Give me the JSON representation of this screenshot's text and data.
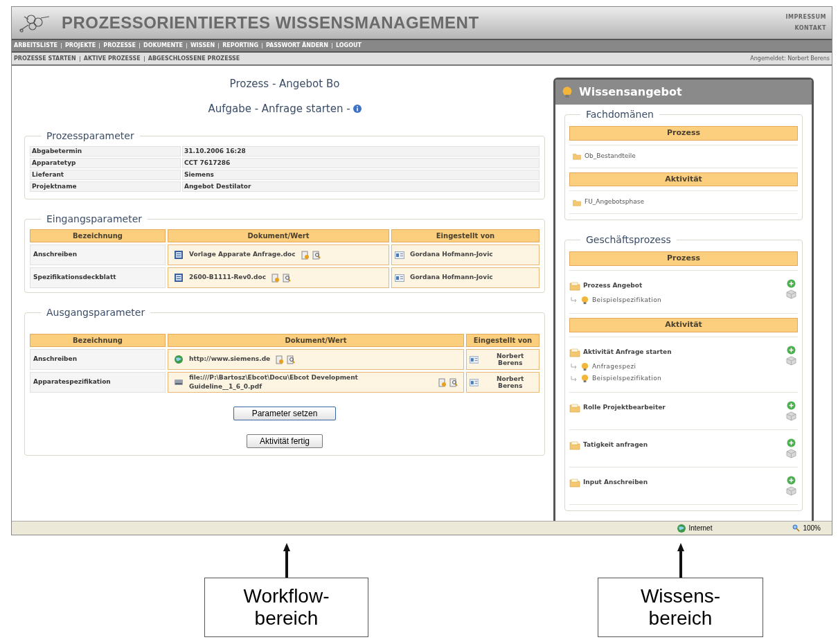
{
  "header": {
    "title": "PROZESSORIENTIERTES WISSENSMANAGEMENT",
    "links": [
      "IMPRESSUM",
      "KONTAKT"
    ]
  },
  "nav": [
    "ARBEITSLISTE",
    "PROJEKTE",
    "PROZESSE",
    "DOKUMENTE",
    "WISSEN",
    "REPORTING",
    "PASSWORT ÄNDERN",
    "LOGOUT"
  ],
  "subnav": {
    "items": [
      "PROZESSE STARTEN",
      "AKTIVE PROZESSE",
      "ABGESCHLOSSENE PROZESSE"
    ],
    "logged_in": "Angemeldet: Norbert Berens"
  },
  "workflow": {
    "process_title": "Prozess - Angebot Bo",
    "task_title": "Aufgabe - Anfrage starten -",
    "prozessparameter": {
      "legend": "Prozessparameter",
      "rows": [
        {
          "label": "Abgabetermin",
          "value": "31.10.2006 16:28"
        },
        {
          "label": "Apparatetyp",
          "value": "CCT 7617286"
        },
        {
          "label": "Lieferant",
          "value": "Siemens"
        },
        {
          "label": "Projektname",
          "value": "Angebot Destilator"
        }
      ]
    },
    "eingangsparameter": {
      "legend": "Eingangsparameter",
      "columns": [
        "Bezeichnung",
        "Dokument/Wert",
        "Eingestellt von"
      ],
      "rows": [
        {
          "name": "Anschreiben",
          "document": "Vorlage Apparate Anfrage.doc",
          "kind": "word",
          "user": "Gordana Hofmann-Jovic"
        },
        {
          "name": "Spezifikationsdeckblatt",
          "document": "2600-B1111-Rev0.doc",
          "kind": "word",
          "user": "Gordana Hofmann-Jovic"
        }
      ]
    },
    "ausgangsparameter": {
      "legend": "Ausgangsparameter",
      "columns": [
        "Bezeichnung",
        "Dokument/Wert",
        "Eingestellt von"
      ],
      "rows": [
        {
          "name": "Anschreiben",
          "document": "http://www.siemens.de",
          "kind": "web",
          "user": "Norbert Berens"
        },
        {
          "name": "Apparatespezifikation",
          "document": "file:///P:\\Bartosz\\Ebcot\\Docu\\Ebcot Development Guideline__1_6_0.pdf",
          "kind": "file",
          "user": "Norbert Berens"
        }
      ]
    },
    "buttons": [
      "Parameter setzen",
      "Aktivität fertig"
    ]
  },
  "knowledge": {
    "title": "Wissensangebot",
    "fachdomaenen": {
      "legend": "Fachdomänen",
      "groups": [
        {
          "heading": "Prozess",
          "items": [
            "Ob_Bestandteile"
          ]
        },
        {
          "heading": "Aktivität",
          "items": [
            "FU_Angebotsphase"
          ]
        }
      ]
    },
    "geschaeftsprozess": {
      "legend": "Geschäftsprozess",
      "groups": [
        {
          "heading": "Prozess",
          "entries": [
            {
              "name": "Prozess Angebot",
              "children": [
                "Beispielspezifikation"
              ]
            }
          ]
        },
        {
          "heading": "Aktivität",
          "entries": [
            {
              "name": "Aktivität Anfrage starten",
              "children": [
                "Anfragespezi",
                "Beispielspezifikation"
              ]
            },
            {
              "name": "Rolle Projektbearbeiter"
            },
            {
              "name": "Tatigkeit anfragen"
            },
            {
              "name": "Input Anschreiben"
            }
          ]
        }
      ]
    }
  },
  "status_bar": {
    "zone": "Internet",
    "zoom": "100%"
  },
  "annotations": [
    {
      "lines": [
        "Workflow-",
        "bereich"
      ]
    },
    {
      "lines": [
        "Wissens-",
        "bereich"
      ]
    }
  ]
}
